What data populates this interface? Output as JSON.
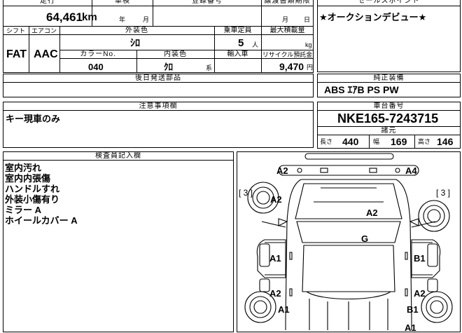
{
  "header": {
    "mileage_label": "走行",
    "shaken_label": "車検",
    "registration_label": "登録番号",
    "transfer_doc_label": "譲渡書類期限",
    "sales_point_label": "セールスポイント"
  },
  "mileage": {
    "value": "64,461",
    "unit": "km"
  },
  "shaken": {
    "year_unit": "年",
    "month_unit": "月"
  },
  "transfer_doc": {
    "month_unit": "月",
    "day_unit": "日"
  },
  "sales_point_text": "★オークションデビュー★",
  "row2": {
    "shift_label": "シフト",
    "aircon_label": "エアコン",
    "exterior_label": "外装色",
    "capacity_label": "乗車定員",
    "max_load_label": "最大積載量",
    "shift_value": "FAT",
    "aircon_value": "AAC",
    "exterior_value": "ｼﾛ",
    "capacity_value": "5",
    "capacity_unit": "人",
    "load_unit": "kg"
  },
  "row3": {
    "color_no_label": "カラーNo.",
    "interior_label": "内装色",
    "import_label": "輸入車",
    "recycle_label": "リサイクル預託金",
    "color_no_value": "040",
    "interior_value": "ｸﾛ",
    "interior_unit": "系",
    "recycle_value": "9,470",
    "recycle_unit": "円"
  },
  "later_parts_label": "後日発送部品",
  "genuine_label": "純正装備",
  "genuine_value": "ABS ｴｱB PS PW",
  "notes_label": "注意事項欄",
  "notes_text": "キー現車のみ",
  "chassis_label": "車台番号",
  "chassis_value": "NKE165-7243715",
  "dims": {
    "label": "諸元",
    "length_label": "長さ",
    "length_value": "440",
    "width_label": "幅",
    "width_value": "169",
    "height_label": "高さ",
    "height_value": "146"
  },
  "inspector": {
    "label": "検査員記入欄",
    "lines": [
      "室内汚れ",
      "室内内張傷",
      "ハンドルすれ",
      "外装小傷有り",
      "ミラー A",
      "ホイールカバー A"
    ]
  },
  "diagram_marks": {
    "front_left": "A2",
    "front_right": "A4",
    "side_left_count": "[ 3 ]",
    "side_right_count": "[ 3 ]",
    "left_fender": "A2",
    "hood": "A2",
    "glass": "G",
    "left_door_front": "A1",
    "right_door_front": "B1",
    "left_door_rear": "A2",
    "right_door_rear": "A2",
    "left_rear_wheel": "A1",
    "right_rear_wheel": "B1",
    "rear_bottom": "A1"
  }
}
